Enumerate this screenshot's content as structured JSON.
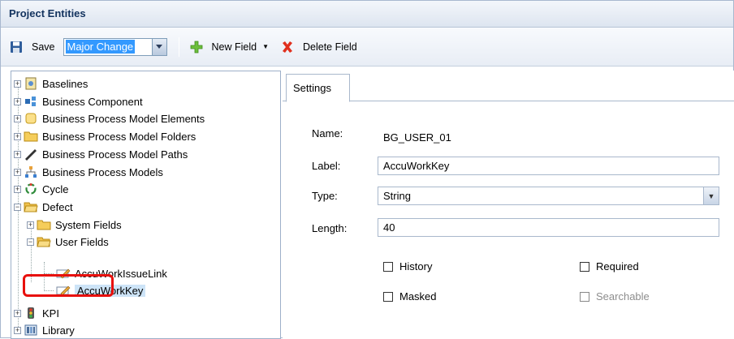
{
  "window": {
    "title": "Project Entities"
  },
  "toolbar": {
    "save_label": "Save",
    "change_type_value": "Major Change",
    "new_field_label": "New Field",
    "delete_field_label": "Delete Field"
  },
  "tree": {
    "items": [
      {
        "label": "Baselines",
        "icon": "baselines-icon",
        "expander": "+"
      },
      {
        "label": "Business Component",
        "icon": "business-component-icon",
        "expander": "+"
      },
      {
        "label": "Business Process Model Elements",
        "icon": "bpm-elements-icon",
        "expander": "+"
      },
      {
        "label": "Business Process Model Folders",
        "icon": "folder-icon",
        "expander": "+"
      },
      {
        "label": "Business Process Model Paths",
        "icon": "bpm-paths-icon",
        "expander": "+"
      },
      {
        "label": "Business Process Models",
        "icon": "bpm-models-icon",
        "expander": "+"
      },
      {
        "label": "Cycle",
        "icon": "cycle-icon",
        "expander": "+"
      },
      {
        "label": "Defect",
        "icon": "folder-open-icon",
        "expander": "−"
      },
      {
        "label": "System Fields",
        "icon": "folder-icon",
        "expander": "+"
      },
      {
        "label": "User Fields",
        "icon": "folder-open-icon",
        "expander": "−"
      },
      {
        "label": "AccuWorkIssueLink",
        "icon": "field-edit-icon"
      },
      {
        "label": "AccuWorkKey",
        "icon": "field-edit-icon"
      },
      {
        "label": "KPI",
        "icon": "kpi-icon",
        "expander": "+"
      },
      {
        "label": "Library",
        "icon": "library-icon",
        "expander": "+"
      }
    ]
  },
  "settings": {
    "tab_label": "Settings",
    "name_label": "Name:",
    "name_value": "BG_USER_01",
    "label_label": "Label:",
    "label_value": "AccuWorkKey",
    "type_label": "Type:",
    "type_value": "String",
    "length_label": "Length:",
    "length_value": "40",
    "history_label": "History",
    "required_label": "Required",
    "masked_label": "Masked",
    "searchable_label": "Searchable"
  },
  "colors": {
    "highlight": "#e8100c",
    "selection": "#cde4f7",
    "header_text": "#12325e"
  }
}
